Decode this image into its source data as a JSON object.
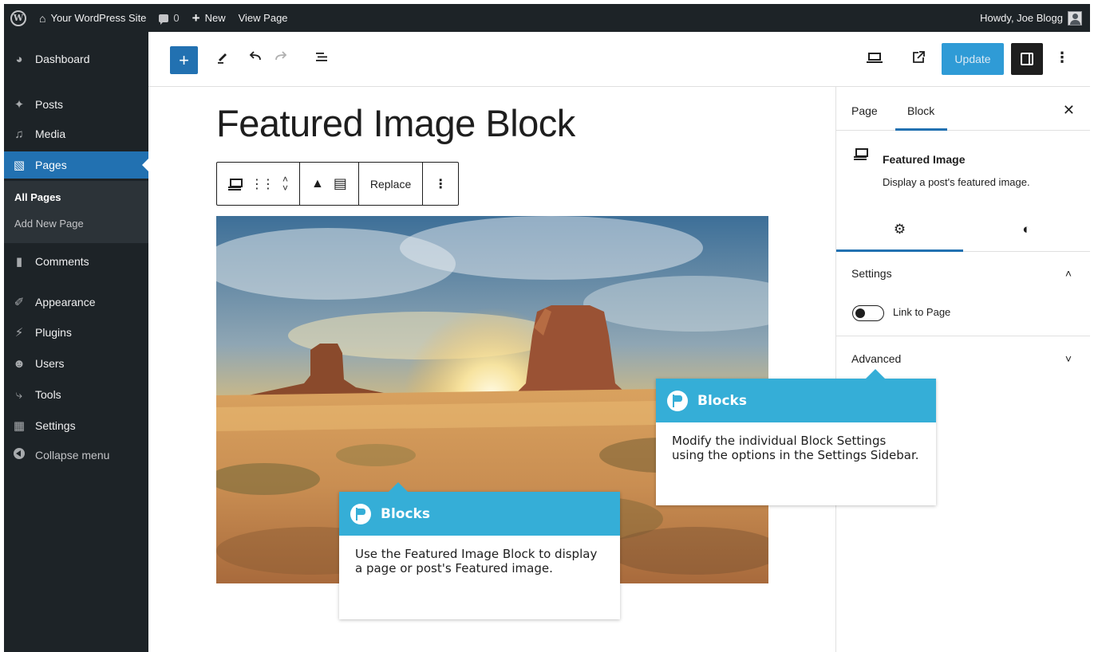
{
  "admin_bar": {
    "site_name": "Your WordPress Site",
    "comments_count": "0",
    "new_label": "New",
    "view_label": "View Page",
    "greeting": "Howdy, Joe Blogg"
  },
  "sidebar": {
    "items": [
      {
        "label": "Dashboard",
        "icon": "dashboard-icon"
      },
      {
        "label": "Posts",
        "icon": "pin-icon"
      },
      {
        "label": "Media",
        "icon": "media-icon"
      },
      {
        "label": "Pages",
        "icon": "pages-icon"
      },
      {
        "label": "Comments",
        "icon": "comment-icon"
      },
      {
        "label": "Appearance",
        "icon": "brush-icon"
      },
      {
        "label": "Plugins",
        "icon": "plug-icon"
      },
      {
        "label": "Users",
        "icon": "users-icon"
      },
      {
        "label": "Tools",
        "icon": "wrench-icon"
      },
      {
        "label": "Settings",
        "icon": "settings-icon"
      },
      {
        "label": "Collapse menu",
        "icon": "collapse-icon"
      }
    ],
    "submenu": [
      "All Pages",
      "Add New Page"
    ]
  },
  "toolbar": {
    "add_label": "+",
    "update_label": "Update"
  },
  "editor": {
    "title": "Featured Image Block",
    "block_toolbar": {
      "replace_label": "Replace"
    }
  },
  "panel": {
    "tabs": [
      "Page",
      "Block"
    ],
    "block_name": "Featured Image",
    "block_description": "Display a post's featured image.",
    "settings_title": "Settings",
    "link_label": "Link to Page",
    "advanced_title": "Advanced"
  },
  "callouts": [
    {
      "title": "Blocks",
      "body": "Modify the individual Block Settings using the options in the Settings Sidebar."
    },
    {
      "title": "Blocks",
      "body": "Use the Featured Image Block to display a page or post's Featured image."
    }
  ],
  "colors": {
    "admin_dark": "#1d2327",
    "accent": "#2271b1",
    "callout_blue": "#35aed7"
  }
}
